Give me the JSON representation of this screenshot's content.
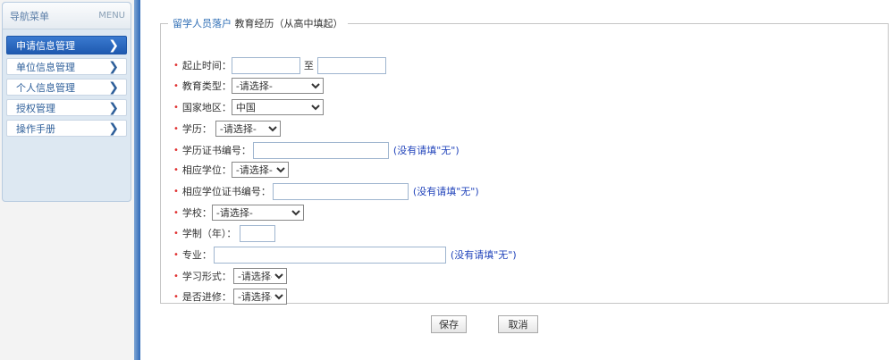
{
  "sidebar": {
    "title": "导航菜单",
    "menu_label": "MENU",
    "items": [
      {
        "label": "申请信息管理",
        "active": true
      },
      {
        "label": "单位信息管理",
        "active": false
      },
      {
        "label": "个人信息管理",
        "active": false
      },
      {
        "label": "授权管理",
        "active": false
      },
      {
        "label": "操作手册",
        "active": false
      }
    ]
  },
  "fieldset": {
    "legend_part1": "留学人员落户",
    "legend_part2": "教育经历（从高中填起）"
  },
  "form": {
    "start_end": {
      "label": "起止时间：",
      "between": "至",
      "start_value": "",
      "end_value": ""
    },
    "edu_type": {
      "label": "教育类型：",
      "selected": "-请选择-"
    },
    "country": {
      "label": "国家地区：",
      "selected": "中国"
    },
    "degree_level": {
      "label": "学历：",
      "selected": "-请选择-"
    },
    "degree_cert_no": {
      "label": "学历证书编号：",
      "value": "",
      "hint": "(没有请填\"无\")"
    },
    "academic_degree": {
      "label": "相应学位：",
      "selected": "-请选择-"
    },
    "academic_degree_cert_no": {
      "label": "相应学位证书编号：",
      "value": "",
      "hint": "(没有请填\"无\")"
    },
    "school": {
      "label": "学校：",
      "selected": "-请选择-"
    },
    "duration": {
      "label": "学制（年）：",
      "value": ""
    },
    "major": {
      "label": "专业：",
      "value": "",
      "hint": "(没有请填\"无\")"
    },
    "study_form": {
      "label": "学习形式：",
      "selected": "-请选择-"
    },
    "further_study": {
      "label": "是否进修：",
      "selected": "-请选择-"
    },
    "required_mark": "•"
  },
  "buttons": {
    "save": "保存",
    "cancel": "取消"
  },
  "colors": {
    "accent": "#2f6eb5",
    "active_nav": "#2566be",
    "required": "#e03030",
    "hint": "#2244bb"
  }
}
